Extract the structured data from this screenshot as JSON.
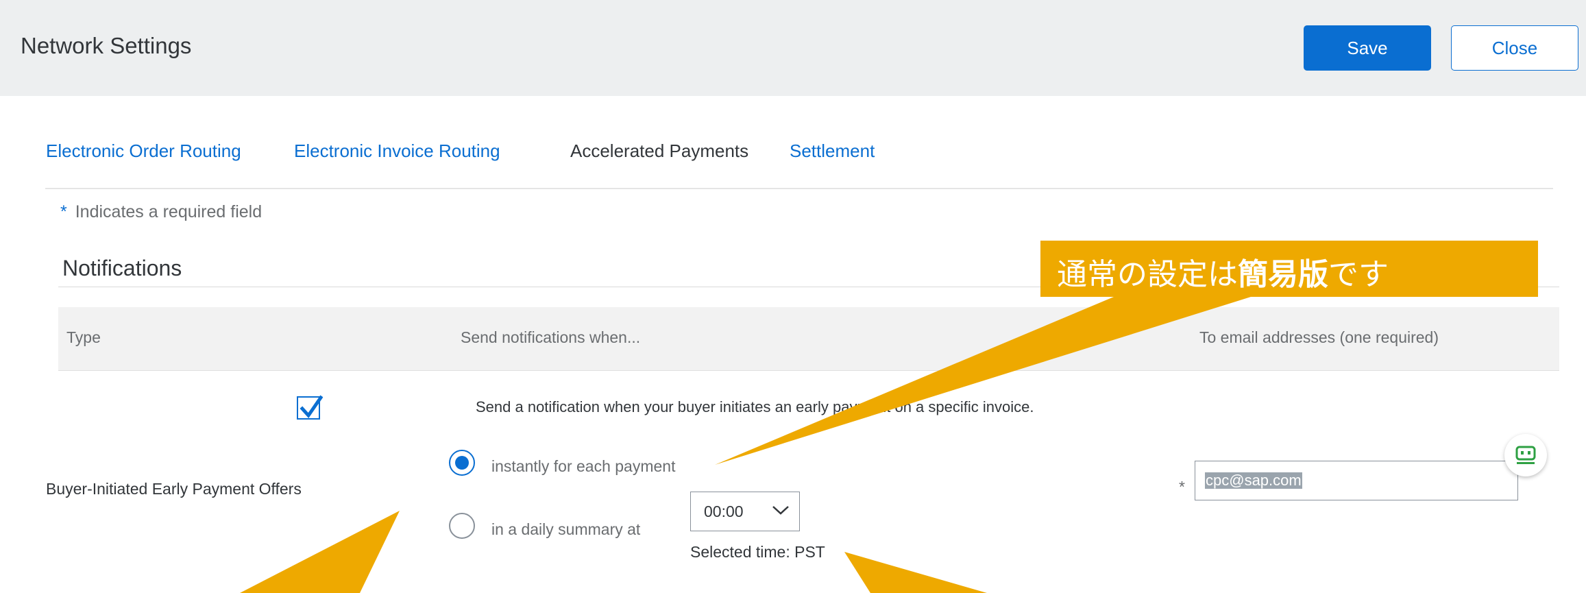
{
  "header": {
    "title": "Network Settings",
    "save_label": "Save",
    "close_label": "Close"
  },
  "tabs": [
    {
      "label": "Electronic Order Routing",
      "active": false
    },
    {
      "label": "Electronic Invoice Routing",
      "active": false
    },
    {
      "label": "Accelerated Payments",
      "active": true
    },
    {
      "label": "Settlement",
      "active": false
    }
  ],
  "required_note": {
    "star": "*",
    "text": "Indicates a required field"
  },
  "section": {
    "title": "Notifications"
  },
  "table": {
    "headers": [
      "Type",
      "Send notifications when...",
      "To email addresses (one required)"
    ],
    "row": {
      "type": "Buyer-Initiated Early Payment Offers",
      "checkbox_label": "Send a notification when your buyer initiates an early payment on a specific invoice.",
      "checkbox_checked": true,
      "radio_instant": "instantly for each payment",
      "radio_daily": "in a daily summary at",
      "selected_radio": "instant",
      "time_value": "00:00",
      "selected_time": "Selected time: PST",
      "email_required_star": "*",
      "email_value": "cpc@sap.com"
    }
  },
  "annotation": {
    "prefix": "通常の設定は",
    "bold": "簡易版",
    "suffix": "です"
  },
  "icons": {
    "checkbox": "checkmark-icon",
    "time_select": "chevron-down-icon",
    "assistant": "assistant-bot-icon"
  },
  "colors": {
    "accent": "#0a6ed1",
    "header_bg": "#edeff0",
    "annotation": "#eea900",
    "assistant_icon": "#2ea043"
  }
}
